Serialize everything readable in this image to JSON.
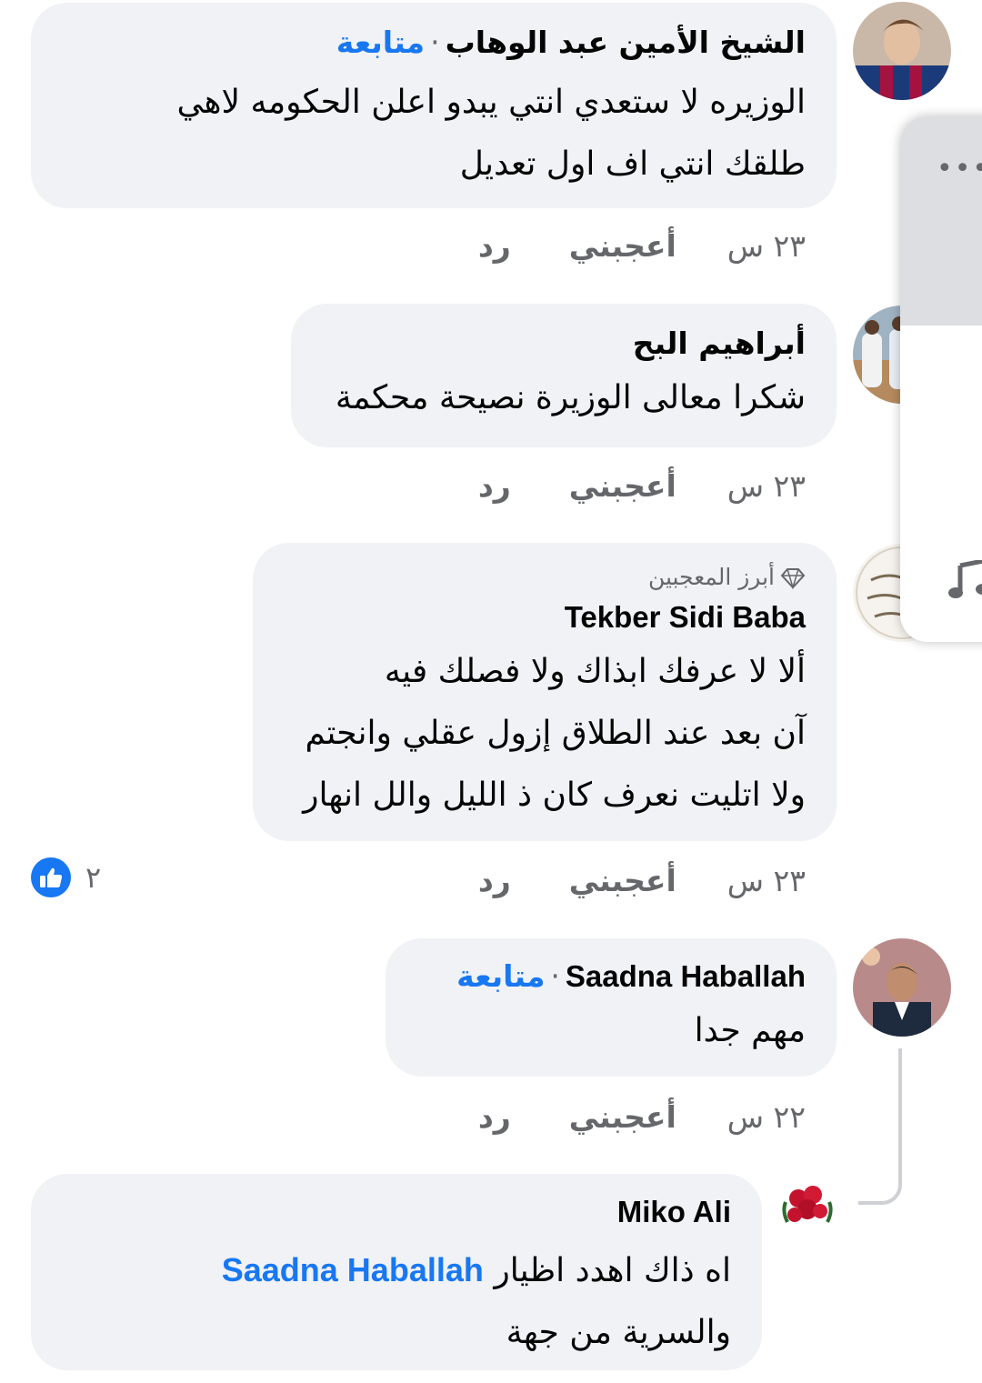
{
  "comments": [
    {
      "author": "الشيخ الأمين عبد الوهاب",
      "follow": "متابعة",
      "lines": [
        "الوزيره لا ستعدي انتي يبدو اعلن الحكومه لاهي",
        "طلقك انتي اف اول تعديل"
      ],
      "time": "٢٣ س",
      "like": "أعجبني",
      "reply": "رد"
    },
    {
      "author": "أبراهيم البح",
      "lines": [
        "شكرا معالى الوزيرة نصيحة محكمة"
      ],
      "time": "٢٣ س",
      "like": "أعجبني",
      "reply": "رد"
    },
    {
      "badge": "أبرز المعجبين",
      "author": "Tekber Sidi Baba",
      "lines": [
        "ألا لا عرفك ابذاك ولا فصلك فيه",
        "آن بعد عند الطلاق إزول عقلي وانجتم",
        "ولا اتليت نعرف كان ذ الليل والل انهار"
      ],
      "time": "٢٣ س",
      "like": "أعجبني",
      "reply": "رد",
      "reaction_count": "٢"
    },
    {
      "author": "Saadna Haballah",
      "follow": "متابعة",
      "lines": [
        "مهم جدا"
      ],
      "time": "٢٢ س",
      "like": "أعجبني",
      "reply": "رد"
    }
  ],
  "reply_comment": {
    "author": "Miko Ali",
    "mention": "Saadna Haballah",
    "line1_text": "اه ذاك اهدد اظيار",
    "line2": "والسرية من جهة"
  },
  "overlay": {
    "menu_icon": "more-dots-icon",
    "music_icon": "music-note-icon"
  },
  "colors": {
    "bubble": "#f0f2f5",
    "accent": "#1877f2",
    "secondary_text": "#65676b"
  }
}
